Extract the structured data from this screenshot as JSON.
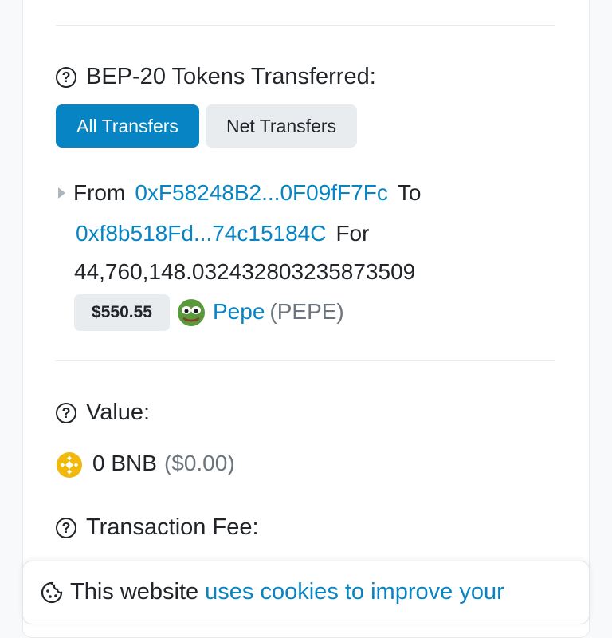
{
  "tokens_section": {
    "title": "BEP-20 Tokens Transferred:",
    "tabs": [
      {
        "label": "All Transfers",
        "active": true
      },
      {
        "label": "Net Transfers",
        "active": false
      }
    ]
  },
  "transfer": {
    "from_label": "From",
    "from_address": "0xF58248B2...0F09fF7Fc",
    "to_label": "To",
    "to_address": "0xf8b518Fd...74c15184C",
    "for_label": "For",
    "amount": "44,760,148.032432803235873509",
    "usd_value": "$550.55",
    "token_name": "Pepe",
    "token_symbol": "(PEPE)",
    "token_icon": "pepe-frog-icon"
  },
  "value_section": {
    "title": "Value:",
    "amount": "0 BNB",
    "usd": "($0.00)",
    "icon": "bnb-coin-icon"
  },
  "fee_section": {
    "title": "Transaction Fee:"
  },
  "cookie_banner": {
    "text": "This website",
    "link_text": "uses cookies to improve your"
  },
  "colors": {
    "accent": "#0784c3",
    "bnb_yellow": "#f0b90b",
    "muted": "#6c757d"
  }
}
